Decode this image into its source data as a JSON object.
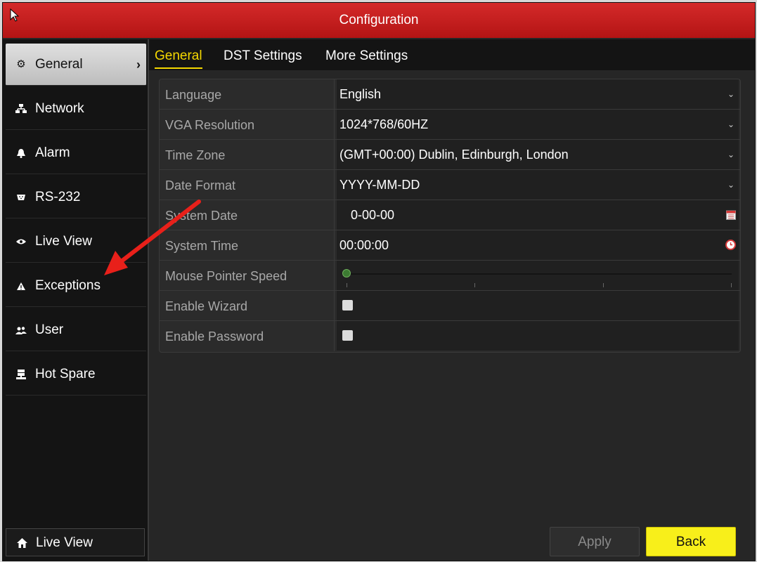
{
  "window": {
    "title": "Configuration"
  },
  "sidebar": {
    "items": [
      {
        "label": "General",
        "icon": "gear-icon",
        "active": true
      },
      {
        "label": "Network",
        "icon": "network-icon"
      },
      {
        "label": "Alarm",
        "icon": "alarm-icon"
      },
      {
        "label": "RS-232",
        "icon": "serial-port-icon"
      },
      {
        "label": "Live View",
        "icon": "eye-icon"
      },
      {
        "label": "Exceptions",
        "icon": "warning-icon"
      },
      {
        "label": "User",
        "icon": "user-icon"
      },
      {
        "label": "Hot Spare",
        "icon": "server-icon"
      }
    ],
    "bottom_button": {
      "label": "Live View",
      "icon": "home-icon"
    }
  },
  "tabs": [
    {
      "label": "General",
      "active": true
    },
    {
      "label": "DST Settings"
    },
    {
      "label": "More Settings"
    }
  ],
  "settings": {
    "language": {
      "label": "Language",
      "value": "English"
    },
    "vga_resolution": {
      "label": "VGA Resolution",
      "value": "1024*768/60HZ"
    },
    "time_zone": {
      "label": "Time Zone",
      "value": "(GMT+00:00) Dublin, Edinburgh, London"
    },
    "date_format": {
      "label": "Date Format",
      "value": "YYYY-MM-DD"
    },
    "system_date": {
      "label": "System Date",
      "value": "0-00-00"
    },
    "system_time": {
      "label": "System Time",
      "value": "00:00:00"
    },
    "mouse_pointer_speed": {
      "label": "Mouse Pointer Speed",
      "level": 0
    },
    "enable_wizard": {
      "label": "Enable Wizard",
      "checked": false
    },
    "enable_password": {
      "label": "Enable Password",
      "checked": false
    }
  },
  "buttons": {
    "apply": "Apply",
    "back": "Back"
  },
  "colors": {
    "title_bar": "#c41e1e",
    "active_tab": "#f5d800",
    "back_button": "#f8ef1a",
    "annotation_arrow": "#e8201a"
  }
}
